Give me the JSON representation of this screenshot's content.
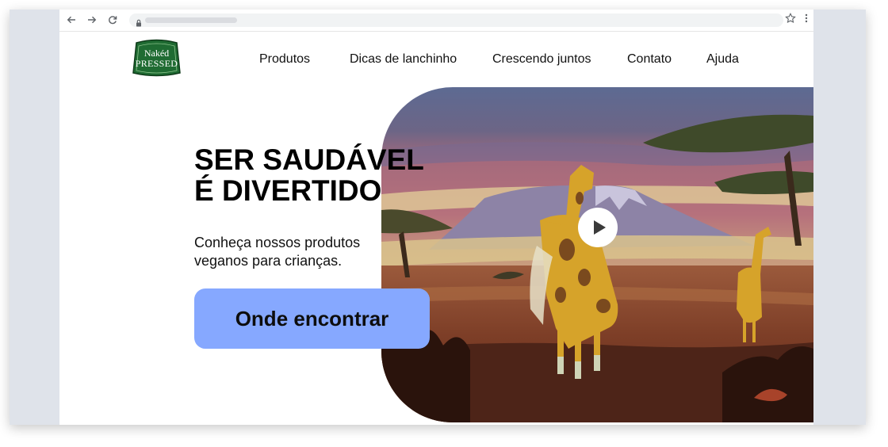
{
  "browser": {
    "icons": [
      "back-icon",
      "forward-icon",
      "reload-icon",
      "lock-icon",
      "star-icon",
      "kebab-menu-icon"
    ]
  },
  "header": {
    "logo": {
      "line1": "Nakéd",
      "line2": "PRESSED"
    },
    "nav": [
      "Produtos",
      "Dicas de lanchinho",
      "Crescendo juntos",
      "Contato",
      "Ajuda"
    ]
  },
  "hero": {
    "title_line1": "SER SAUDÁVEL",
    "title_line2": "É DIVERTIDO",
    "subtitle_line1": "Conheça nossos produtos",
    "subtitle_line2": "veganos para crianças.",
    "cta_label": "Onde encontrar",
    "video_icon": "play-icon"
  },
  "colors": {
    "cta": "#86a8ff",
    "logo_green": "#1f6b32",
    "frame_bg": "#dfe3ea"
  }
}
